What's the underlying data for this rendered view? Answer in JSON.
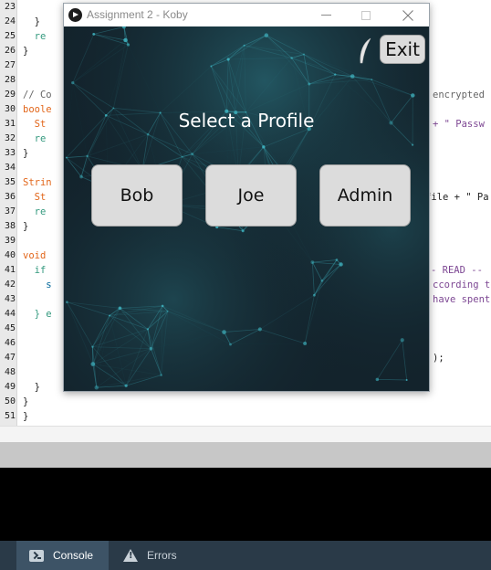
{
  "editor": {
    "line_numbers": [
      "23",
      "24",
      "25",
      "26",
      "27",
      "28",
      "29",
      "30",
      "31",
      "32",
      "33",
      "34",
      "35",
      "36",
      "37",
      "38",
      "39",
      "40",
      "41",
      "42",
      "43",
      "44",
      "45",
      "46",
      "47",
      "48",
      "49",
      "50",
      "51"
    ],
    "visible_fragments": {
      "l25": "re",
      "l26": "}",
      "l29a": "// Co",
      "l29b": "encrypted",
      "l30": "boole",
      "l31a": "St",
      "l31b": "+ \" Passw",
      "l32": "re",
      "l33": "}",
      "l35": "Strin",
      "l36a": "St",
      "l36b": "file + \" Pa",
      "l37": "re",
      "l38": "}",
      "l40": "void",
      "l41a": "if",
      "l41b": "- READ --",
      "l42a": "s",
      "l42b": "ccording to",
      "l43b": "have spent",
      "l44": "} e",
      "l47b": ");",
      "l49": "}",
      "l50": "}",
      "l51": "}"
    }
  },
  "console_tabs": [
    {
      "label": "Console",
      "icon": "terminal-icon",
      "active": true
    },
    {
      "label": "Errors",
      "icon": "warning-icon",
      "active": false
    }
  ],
  "window": {
    "title": "Assignment 2 - Koby",
    "controls": {
      "minimize": "minimize-icon",
      "maximize": "maximize-icon",
      "close": "close-icon"
    },
    "app": {
      "heading": "Select a Profile",
      "profiles": [
        "Bob",
        "Joe",
        "Admin"
      ],
      "exit_label": "Exit"
    }
  },
  "colors": {
    "canvas_bg": "#13232c",
    "network_lines": "#3fb3c0",
    "button_face": "#dcdcdc",
    "console_tab_active": "#3d5366",
    "tabbar": "#2a3a48"
  }
}
